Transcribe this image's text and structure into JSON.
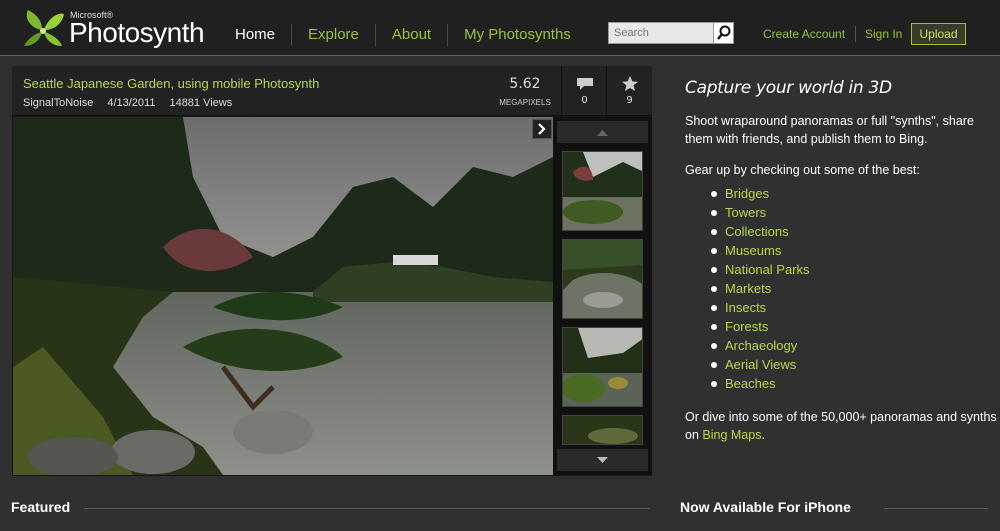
{
  "header": {
    "logo_small": "Microsoft®",
    "logo_word": "Photosynth",
    "nav": [
      {
        "label": "Home"
      },
      {
        "label": "Explore"
      },
      {
        "label": "About"
      },
      {
        "label": "My Photosynths"
      }
    ],
    "search": {
      "placeholder": "Search",
      "icon": "search-icon"
    },
    "create_account": "Create Account",
    "sign_in": "Sign In",
    "upload": "Upload"
  },
  "viewer": {
    "title": "Seattle Japanese Garden, using mobile Photosynth",
    "author": "SignalToNoise",
    "date": "4/13/2011",
    "views": "14881 Views",
    "megapixels": "5.62",
    "megapixels_label": "MEGAPIXELS",
    "comments": "0",
    "favorites": "9"
  },
  "side": {
    "heading": "Capture your world in 3D",
    "intro": "Shoot wraparound panoramas or full \"synths\", share them with friends, and publish them to Bing.",
    "gear_up": "Gear up by checking out some of the best:",
    "best": [
      "Bridges",
      "Towers",
      "Collections",
      "Museums",
      "National Parks",
      "Markets",
      "Insects",
      "Forests",
      "Archaeology",
      "Aerial Views",
      "Beaches"
    ],
    "dive_pre": "Or dive into some of the 50,000+ panoramas and synths on ",
    "bing_maps": "Bing Maps",
    "dive_post": "."
  },
  "sections": {
    "featured": "Featured",
    "iphone": "Now Available For iPhone"
  },
  "colors": {
    "accent": "#9bc23c",
    "background": "#303030",
    "header": "#202020"
  }
}
